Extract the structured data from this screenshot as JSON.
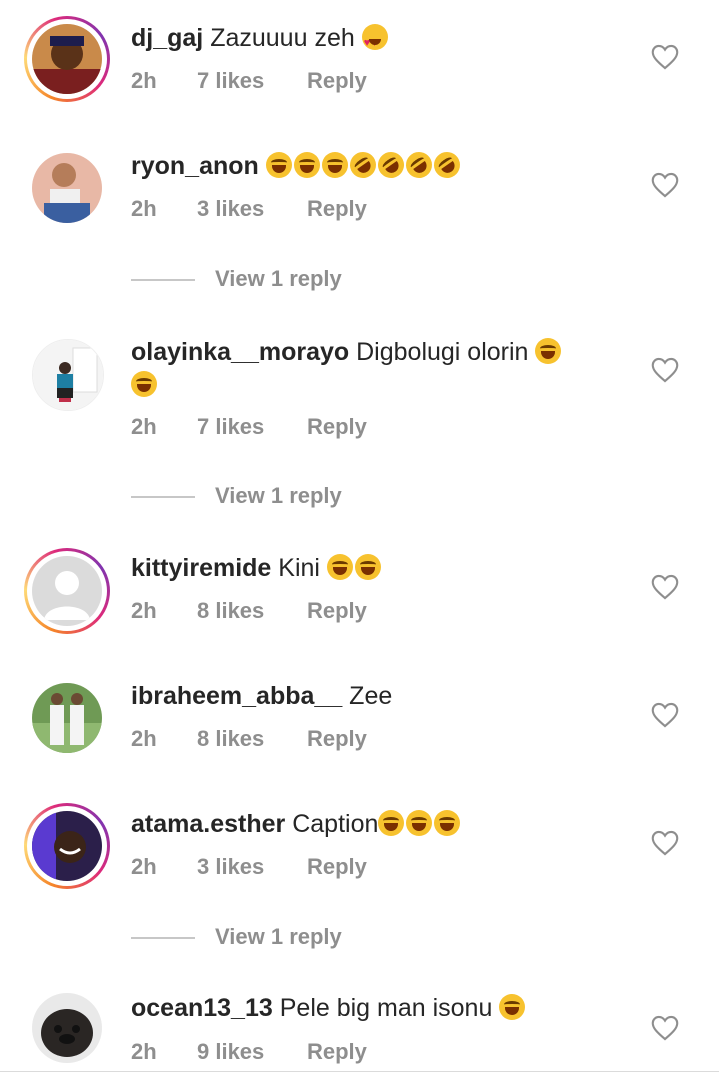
{
  "comments": [
    {
      "username": "dj_gaj",
      "text": "Zazuuuu zeh",
      "emojis": [
        "heart-eyes"
      ],
      "time": "2h",
      "likes": "7 likes",
      "reply": "Reply",
      "story": true,
      "view_replies": ""
    },
    {
      "username": "ryon_anon",
      "text": "",
      "emojis": [
        "joy",
        "joy",
        "joy",
        "rofl",
        "rofl",
        "rofl",
        "rofl"
      ],
      "time": "2h",
      "likes": "3 likes",
      "reply": "Reply",
      "story": false,
      "view_replies": "View 1 reply"
    },
    {
      "username": "olayinka__morayo",
      "text": "Digbolugi olorin",
      "emojis": [
        "joy"
      ],
      "emojis_line2": [
        "joy"
      ],
      "time": "2h",
      "likes": "7 likes",
      "reply": "Reply",
      "story": false,
      "view_replies": "View 1 reply"
    },
    {
      "username": "kittyiremide",
      "text": "Kini",
      "emojis": [
        "joy",
        "joy"
      ],
      "time": "2h",
      "likes": "8 likes",
      "reply": "Reply",
      "story": true,
      "view_replies": ""
    },
    {
      "username": "ibraheem_abba__",
      "text": "Zee",
      "emojis": [],
      "time": "2h",
      "likes": "8 likes",
      "reply": "Reply",
      "story": false,
      "view_replies": ""
    },
    {
      "username": "atama.esther",
      "text": "Caption",
      "emojis": [
        "joy",
        "joy",
        "joy"
      ],
      "time": "2h",
      "likes": "3 likes",
      "reply": "Reply",
      "story": true,
      "view_replies": "View 1 reply"
    },
    {
      "username": "ocean13_13",
      "text": "Pele big man isonu",
      "emojis": [
        "joy"
      ],
      "time": "2h",
      "likes": "9 likes",
      "reply": "Reply",
      "story": false,
      "view_replies": ""
    }
  ],
  "colors": {
    "text": "#262626",
    "meta": "#8e8e8e",
    "story_ring": "#dd2a7b"
  },
  "icons": {
    "like": "heart-outline-icon"
  }
}
